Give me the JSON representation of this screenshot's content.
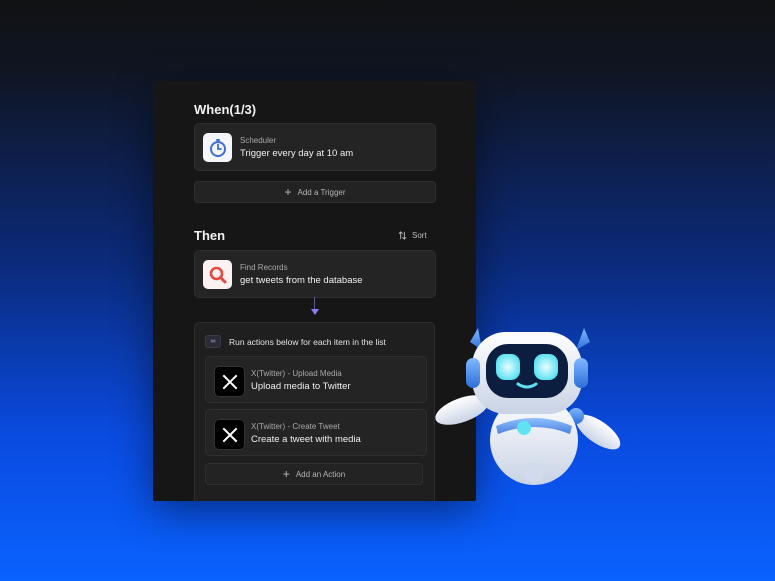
{
  "when": {
    "title": "When(1/3)",
    "trigger": {
      "sub": "Scheduler",
      "main": "Trigger every day at 10 am",
      "icon": "stopwatch-icon"
    },
    "add_trigger_label": "Add a Trigger"
  },
  "then": {
    "title": "Then",
    "sort_label": "Sort",
    "find": {
      "sub": "Find Records",
      "main": "get tweets from the database",
      "icon": "magnifier-icon"
    },
    "loop": {
      "label": "Run actions below for each item in the list",
      "actions": [
        {
          "sub": "X(Twitter) - Upload Media",
          "main": "Upload media to Twitter"
        },
        {
          "sub": "X(Twitter) - Create Tweet",
          "main": "Create a tweet with media"
        }
      ],
      "add_action_label": "Add an Action"
    }
  },
  "colors": {
    "accent": "#8a7cff",
    "scheduler_blue": "#4a7bd8",
    "find_red": "#e5483f"
  }
}
